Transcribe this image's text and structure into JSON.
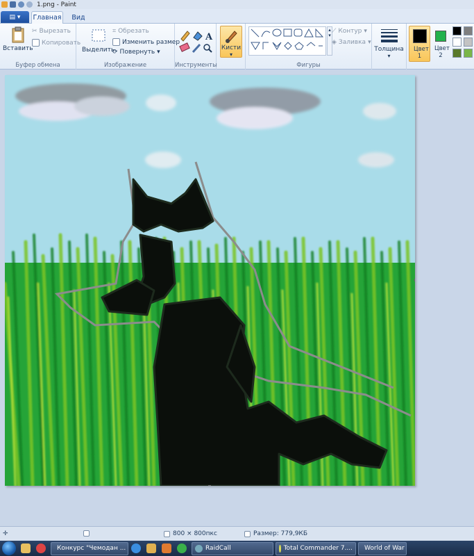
{
  "window": {
    "title": "1.png - Paint"
  },
  "tabs": {
    "file": "▤ ▾",
    "home": "Главная",
    "view": "Вид"
  },
  "clipboard": {
    "paste": "Вставить",
    "cut": "Вырезать",
    "copy": "Копировать",
    "label": "Буфер обмена"
  },
  "image": {
    "select": "Выделить",
    "crop": "Обрезать",
    "resize": "Изменить размер",
    "rotate": "Повернуть",
    "label": "Изображение"
  },
  "tools": {
    "label": "Инструменты"
  },
  "brushes": {
    "label": "Кисти"
  },
  "shapes": {
    "outline": "Контур",
    "fill": "Заливка",
    "label": "Фигуры"
  },
  "size": {
    "label": "Толщина"
  },
  "colors": {
    "color1_label": "Цвет 1",
    "color1": "#000000",
    "color2_label": "Цвет 2",
    "color2": "#22b14c",
    "palette": [
      "#000000",
      "#7f7f7f",
      "#ffffff",
      "#c3c3c3",
      "#5a7a2a",
      "#7ab648"
    ]
  },
  "status": {
    "dimensions": "800 × 800пкс",
    "filesize": "Размер: 779,9КБ"
  },
  "taskbar": {
    "items": [
      "Конкурс \"Чемодан ...",
      "RaidCall",
      "Total Commander 7....",
      "World of War"
    ]
  }
}
